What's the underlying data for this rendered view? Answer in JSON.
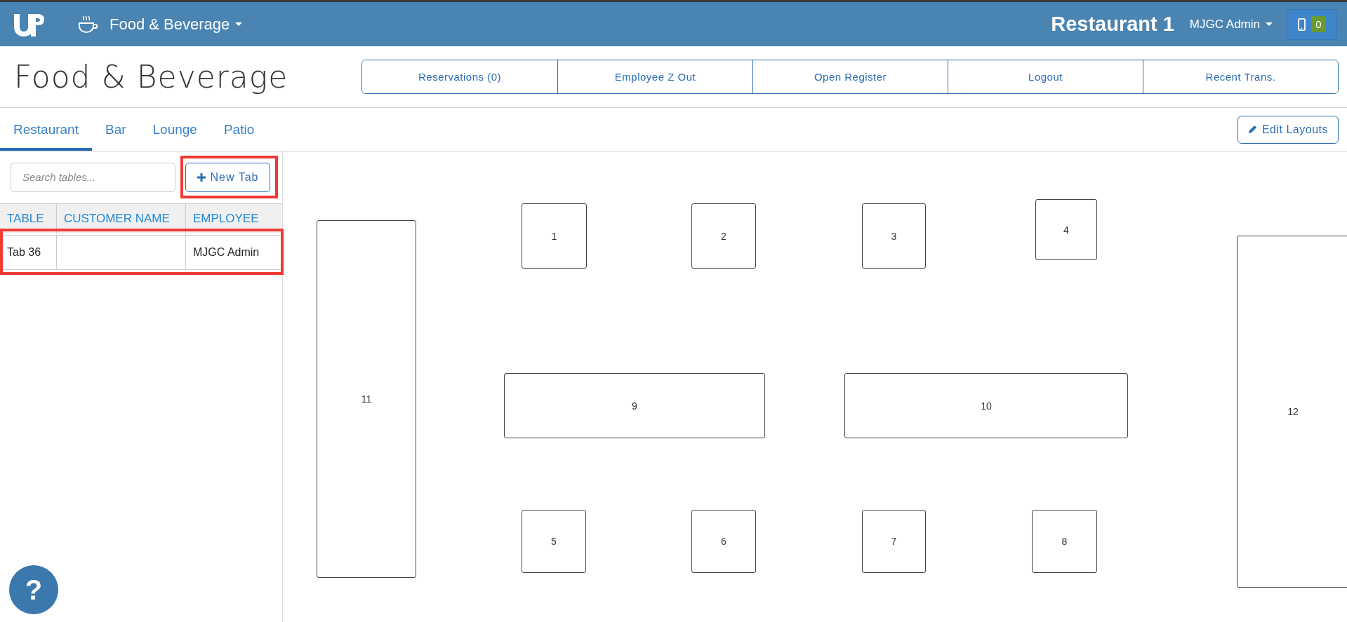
{
  "topbar": {
    "module": "Food & Beverage",
    "location": "Restaurant 1",
    "user": "MJGC Admin",
    "device_count": "0"
  },
  "header": {
    "title": "Food & Beverage",
    "actions": [
      "Reservations (0)",
      "Employee Z Out",
      "Open Register",
      "Logout",
      "Recent Trans."
    ]
  },
  "tabs": [
    {
      "label": "Restaurant",
      "selected": true
    },
    {
      "label": "Bar",
      "selected": false
    },
    {
      "label": "Lounge",
      "selected": false
    },
    {
      "label": "Patio",
      "selected": false
    }
  ],
  "edit_button": "Edit Layouts",
  "search": {
    "placeholder": "Search tables..."
  },
  "new_tab_button": "New Tab",
  "table": {
    "columns": [
      "TABLE",
      "CUSTOMER NAME",
      "EMPLOYEE"
    ],
    "rows": [
      [
        "Tab 36",
        "",
        "MJGC Admin"
      ]
    ]
  },
  "floor_tables": [
    "1",
    "2",
    "3",
    "4",
    "5",
    "6",
    "7",
    "8",
    "9",
    "10",
    "11",
    "12"
  ],
  "help_button": "?"
}
